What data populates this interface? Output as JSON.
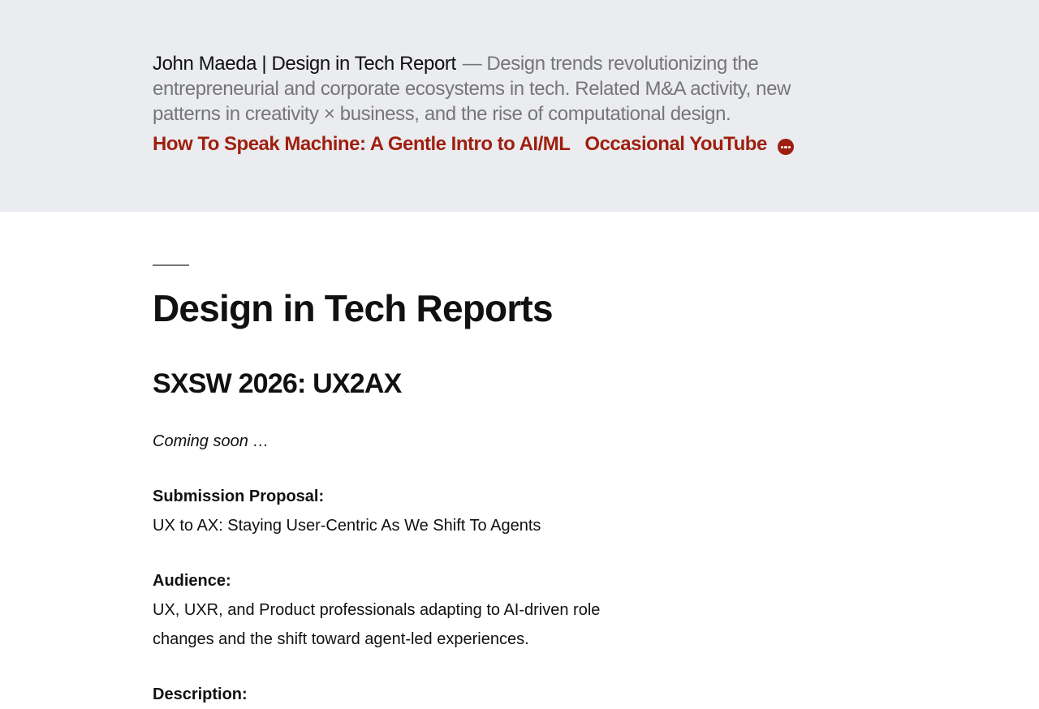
{
  "header": {
    "site_title": "John Maeda | Design in Tech Report",
    "separator": "—",
    "tagline": "Design trends revolutionizing the entrepreneurial and corporate ecosystems in tech. Related M&A activity, new patterns in creativity × business, and the rise of computational design.",
    "nav": [
      {
        "label": "How To Speak Machine: A Gentle Intro to AI/ML"
      },
      {
        "label": "Occasional YouTube"
      }
    ],
    "more_icon": "more-horizontal-icon",
    "accent_color": "#9e1f0f",
    "background_color": "#ebecef"
  },
  "main": {
    "page_title": "Design in Tech Reports",
    "section_heading": "SXSW 2026: UX2AX",
    "coming_soon": "Coming soon …",
    "submission_label": "Submission Proposal:",
    "submission_value": "UX to AX: Staying User-Centric As We Shift To Agents",
    "audience_label": "Audience:",
    "audience_value": "UX, UXR, and Product professionals adapting to AI-driven role changes and the shift toward agent-led experiences.",
    "description_label": "Description:"
  }
}
